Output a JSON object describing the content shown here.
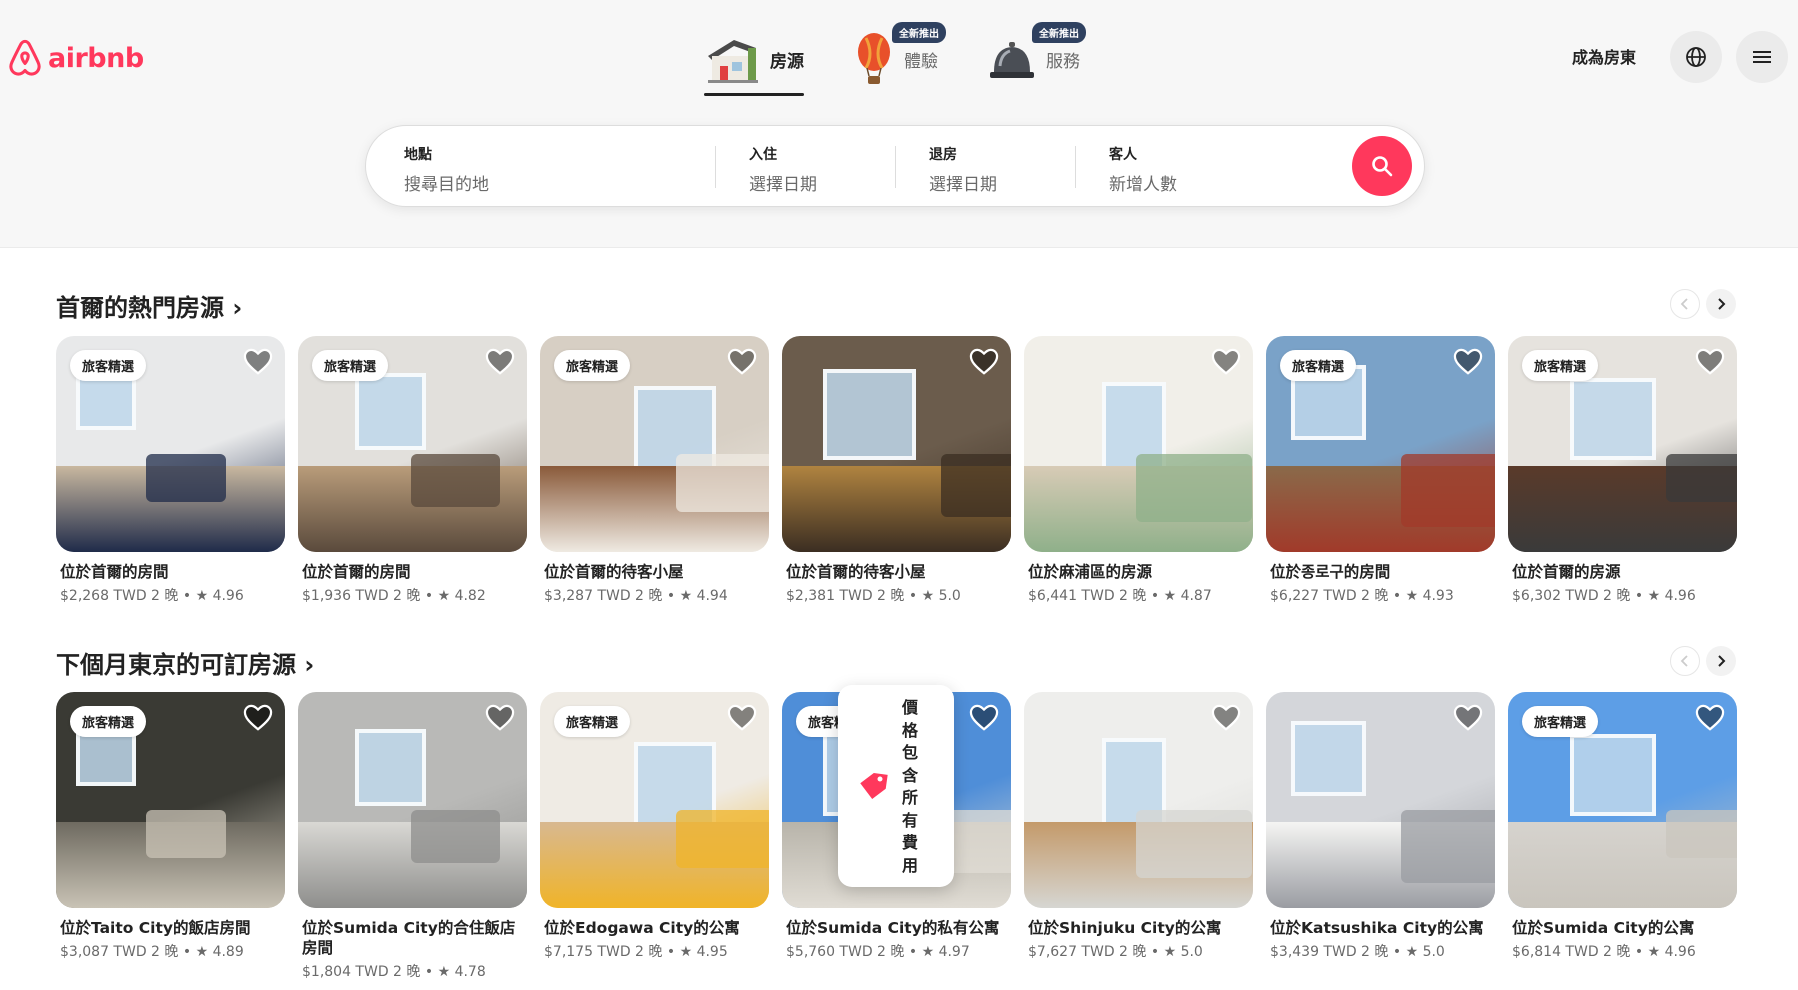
{
  "brand": {
    "name": "airbnb",
    "color": "#ff385c"
  },
  "nav": {
    "tabs": [
      {
        "label": "房源",
        "icon": "house-icon",
        "active": true
      },
      {
        "label": "體驗",
        "icon": "hot-air-balloon-icon",
        "badge": "全新推出"
      },
      {
        "label": "服務",
        "icon": "service-bell-icon",
        "badge": "全新推出"
      }
    ]
  },
  "header": {
    "host_link": "成為房東",
    "globe_icon": "globe-icon",
    "menu_icon": "menu-icon"
  },
  "search": {
    "where": {
      "title": "地點",
      "placeholder": "搜尋目的地"
    },
    "checkin": {
      "title": "入住",
      "placeholder": "選擇日期"
    },
    "checkout": {
      "title": "退房",
      "placeholder": "選擇日期"
    },
    "guests": {
      "title": "客人",
      "placeholder": "新增人數"
    },
    "button_icon": "search-icon"
  },
  "sections": [
    {
      "title": "首爾的熱門房源 ›",
      "cards": [
        {
          "badge": "旅客精選",
          "title": "位於首爾的房間",
          "meta": "$2,268 TWD 2 晚 • ★ 4.96",
          "c1": "#e8e9ea",
          "c2": "#c9b8a0",
          "c3": "#1f2b4a"
        },
        {
          "badge": "旅客精選",
          "title": "位於首爾的房間",
          "meta": "$1,936 TWD 2 晚 • ★ 4.82",
          "c1": "#e2e0dc",
          "c2": "#b99c7a",
          "c3": "#5a4a3c"
        },
        {
          "badge": "旅客精選",
          "title": "位於首爾的待客小屋",
          "meta": "$3,287 TWD 2 晚 • ★ 4.94",
          "c1": "#d7cfc4",
          "c2": "#8a5a3a",
          "c3": "#efeae2"
        },
        {
          "badge": "",
          "title": "位於首爾的待客小屋",
          "meta": "$2,381 TWD 2 晚 • ★ 5.0",
          "c1": "#6b5c4c",
          "c2": "#b08440",
          "c3": "#3b2e22"
        },
        {
          "badge": "",
          "title": "位於麻浦區的房源",
          "meta": "$6,441 TWD 2 晚 • ★ 4.87",
          "c1": "#f1efe9",
          "c2": "#d8cbb6",
          "c3": "#8fb08a"
        },
        {
          "badge": "旅客精選",
          "title": "位於종로구的房間",
          "meta": "$6,227 TWD 2 晚 • ★ 4.93",
          "c1": "#7aa2c8",
          "c2": "#8a6a4a",
          "c3": "#a13a2a"
        },
        {
          "badge": "旅客精選",
          "title": "位於首爾的房源",
          "meta": "$6,302 TWD 2 晚 • ★ 4.96",
          "c1": "#e6e3de",
          "c2": "#5a3a2a",
          "c3": "#3a3a3a"
        }
      ]
    },
    {
      "title": "下個月東京的可訂房源 ›",
      "cards": [
        {
          "badge": "旅客精選",
          "title": "位於Taito City的飯店房間",
          "meta": "$3,087 TWD 2 晚 • ★ 4.89",
          "c1": "#3a3a34",
          "c2": "#6e6a60",
          "c3": "#c9c3b5"
        },
        {
          "badge": "",
          "title": "位於Sumida City的合住飯店房間",
          "meta": "$1,804 TWD 2 晚 • ★ 4.78",
          "c1": "#b9b9b7",
          "c2": "#d9d8d4",
          "c3": "#8e8e8c"
        },
        {
          "badge": "旅客精選",
          "title": "位於Edogawa City的公寓",
          "meta": "$7,175 TWD 2 晚 • ★ 4.95",
          "c1": "#efebe4",
          "c2": "#d8b890",
          "c3": "#f0b428"
        },
        {
          "badge": "旅客精選",
          "title": "位於Sumida City的私有公寓",
          "meta": "$5,760 TWD 2 晚 • ★ 4.97",
          "c1": "#4f8ed8",
          "c2": "#b8b4aa",
          "c3": "#e0dcd4"
        },
        {
          "badge": "",
          "title": "位於Shinjuku City的公寓",
          "meta": "$7,627 TWD 2 晚 • ★ 5.0",
          "c1": "#eeeeec",
          "c2": "#c49a6a",
          "c3": "#d6d6d2"
        },
        {
          "badge": "",
          "title": "位於Katsushika City的公寓",
          "meta": "$3,439 TWD 2 晚 • ★ 5.0",
          "c1": "#d4d6da",
          "c2": "#f5f5f3",
          "c3": "#9a9ca2"
        },
        {
          "badge": "旅客精選",
          "title": "位於Sumida City的公寓",
          "meta": "$6,814 TWD 2 晚 • ★ 4.96",
          "c1": "#5d9ee6",
          "c2": "#d6d3ce",
          "c3": "#c9c5bd"
        }
      ]
    }
  ],
  "tooltip": {
    "text": "價格包含所有費用",
    "icon": "price-tag-icon",
    "tag_color": "#ff385c"
  }
}
